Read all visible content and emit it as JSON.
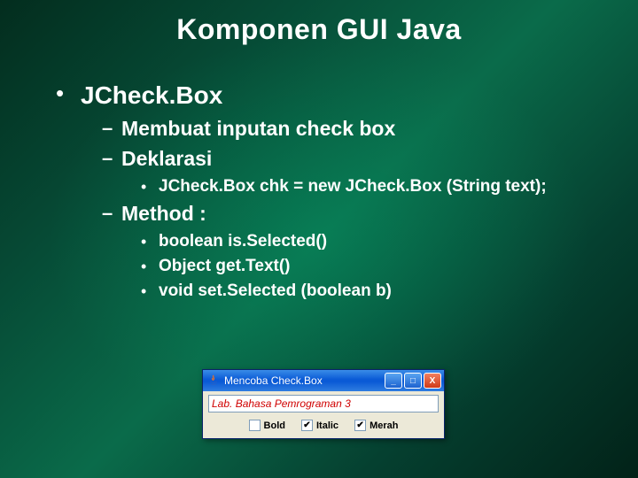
{
  "title": "Komponen GUI Java",
  "bullets": {
    "l1": "JCheck.Box",
    "l2_1": "Membuat inputan check box",
    "l2_2": "Deklarasi",
    "l3_decl": "JCheck.Box chk = new JCheck.Box (String text);",
    "l2_3": "Method :",
    "l3_m1": "boolean is.Selected()",
    "l3_m2": "Object get.Text()",
    "l3_m3": "void set.Selected (boolean b)"
  },
  "window": {
    "title": "Mencoba Check.Box",
    "textfield_value": "Lab. Bahasa Pemrograman 3",
    "checks": {
      "bold": {
        "label": "Bold",
        "checked": false
      },
      "italic": {
        "label": "Italic",
        "checked": true
      },
      "merah": {
        "label": "Merah",
        "checked": true
      }
    },
    "buttons": {
      "min": "_",
      "max": "□",
      "close": "X"
    }
  }
}
